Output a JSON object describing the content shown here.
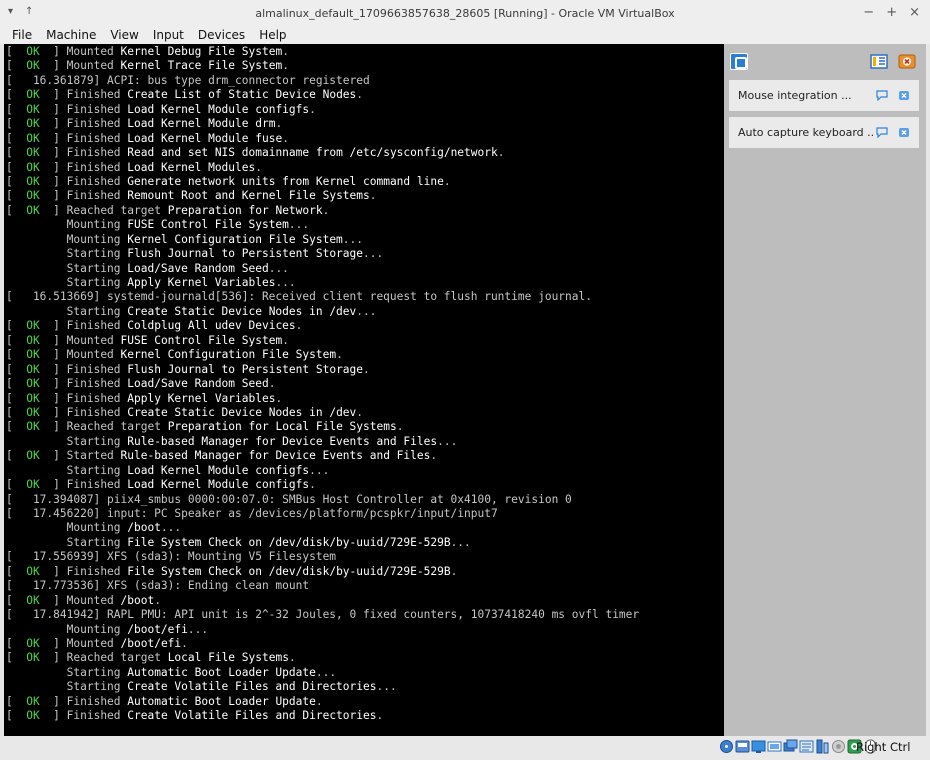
{
  "window": {
    "title": "almalinux_default_1709663857638_28605 [Running] - Oracle VM VirtualBox",
    "controls": {
      "minimize": "−",
      "maximize": "+",
      "close": "×"
    },
    "left_glyphs": [
      "▾",
      "↑"
    ]
  },
  "menubar": {
    "items": [
      "File",
      "Machine",
      "View",
      "Input",
      "Devices",
      "Help"
    ]
  },
  "console": {
    "lines": [
      [
        "[  ",
        {
          "ok": "OK"
        },
        "  ] Mounted ",
        {
          "hl": "Kernel Debug File System"
        },
        "."
      ],
      [
        "[  ",
        {
          "ok": "OK"
        },
        "  ] Mounted ",
        {
          "hl": "Kernel Trace File System"
        },
        "."
      ],
      [
        "[   16.361879] ACPI: bus type drm_connector registered"
      ],
      [
        "[  ",
        {
          "ok": "OK"
        },
        "  ] Finished ",
        {
          "hl": "Create List of Static Device Nodes"
        },
        "."
      ],
      [
        "[  ",
        {
          "ok": "OK"
        },
        "  ] Finished ",
        {
          "hl": "Load Kernel Module configfs"
        },
        "."
      ],
      [
        "[  ",
        {
          "ok": "OK"
        },
        "  ] Finished ",
        {
          "hl": "Load Kernel Module drm"
        },
        "."
      ],
      [
        "[  ",
        {
          "ok": "OK"
        },
        "  ] Finished ",
        {
          "hl": "Load Kernel Module fuse"
        },
        "."
      ],
      [
        "[  ",
        {
          "ok": "OK"
        },
        "  ] Finished ",
        {
          "hl": "Read and set NIS domainname from /etc/sysconfig/network"
        },
        "."
      ],
      [
        "[  ",
        {
          "ok": "OK"
        },
        "  ] Finished ",
        {
          "hl": "Load Kernel Modules"
        },
        "."
      ],
      [
        "[  ",
        {
          "ok": "OK"
        },
        "  ] Finished ",
        {
          "hl": "Generate network units from Kernel command line"
        },
        "."
      ],
      [
        "[  ",
        {
          "ok": "OK"
        },
        "  ] Finished ",
        {
          "hl": "Remount Root and Kernel File Systems"
        },
        "."
      ],
      [
        "[  ",
        {
          "ok": "OK"
        },
        "  ] Reached target ",
        {
          "hl": "Preparation for Network"
        },
        "."
      ],
      [
        "         Mounting ",
        {
          "hl": "FUSE Control File System"
        },
        "..."
      ],
      [
        "         Mounting ",
        {
          "hl": "Kernel Configuration File System"
        },
        "..."
      ],
      [
        "         Starting ",
        {
          "hl": "Flush Journal to Persistent Storage"
        },
        "..."
      ],
      [
        "         Starting ",
        {
          "hl": "Load/Save Random Seed"
        },
        "..."
      ],
      [
        "         Starting ",
        {
          "hl": "Apply Kernel Variables"
        },
        "..."
      ],
      [
        "[   16.513669] systemd-journald[536]: Received client request to flush runtime journal."
      ],
      [
        "         Starting ",
        {
          "hl": "Create Static Device Nodes in /dev"
        },
        "..."
      ],
      [
        "[  ",
        {
          "ok": "OK"
        },
        "  ] Finished ",
        {
          "hl": "Coldplug All udev Devices"
        },
        "."
      ],
      [
        "[  ",
        {
          "ok": "OK"
        },
        "  ] Mounted ",
        {
          "hl": "FUSE Control File System"
        },
        "."
      ],
      [
        "[  ",
        {
          "ok": "OK"
        },
        "  ] Mounted ",
        {
          "hl": "Kernel Configuration File System"
        },
        "."
      ],
      [
        "[  ",
        {
          "ok": "OK"
        },
        "  ] Finished ",
        {
          "hl": "Flush Journal to Persistent Storage"
        },
        "."
      ],
      [
        "[  ",
        {
          "ok": "OK"
        },
        "  ] Finished ",
        {
          "hl": "Load/Save Random Seed"
        },
        "."
      ],
      [
        "[  ",
        {
          "ok": "OK"
        },
        "  ] Finished ",
        {
          "hl": "Apply Kernel Variables"
        },
        "."
      ],
      [
        "[  ",
        {
          "ok": "OK"
        },
        "  ] Finished ",
        {
          "hl": "Create Static Device Nodes in /dev"
        },
        "."
      ],
      [
        "[  ",
        {
          "ok": "OK"
        },
        "  ] Reached target ",
        {
          "hl": "Preparation for Local File Systems"
        },
        "."
      ],
      [
        "         Starting ",
        {
          "hl": "Rule-based Manager for Device Events and Files"
        },
        "..."
      ],
      [
        "[  ",
        {
          "ok": "OK"
        },
        "  ] Started ",
        {
          "hl": "Rule-based Manager for Device Events and Files"
        },
        "."
      ],
      [
        "         Starting ",
        {
          "hl": "Load Kernel Module configfs"
        },
        "..."
      ],
      [
        "[  ",
        {
          "ok": "OK"
        },
        "  ] Finished ",
        {
          "hl": "Load Kernel Module configfs"
        },
        "."
      ],
      [
        "[   17.394087] piix4_smbus 0000:00:07.0: SMBus Host Controller at 0x4100, revision 0"
      ],
      [
        "[   17.456220] input: PC Speaker as /devices/platform/pcspkr/input/input7"
      ],
      [
        "         Mounting ",
        {
          "hl": "/boot"
        },
        "..."
      ],
      [
        "         Starting ",
        {
          "hl": "File System Check on /dev/disk/by-uuid/729E-529B"
        },
        "..."
      ],
      [
        "[   17.556939] XFS (sda3): Mounting V5 Filesystem"
      ],
      [
        "[  ",
        {
          "ok": "OK"
        },
        "  ] Finished ",
        {
          "hl": "File System Check on /dev/disk/by-uuid/729E-529B"
        },
        "."
      ],
      [
        "[   17.773536] XFS (sda3): Ending clean mount"
      ],
      [
        "[  ",
        {
          "ok": "OK"
        },
        "  ] Mounted ",
        {
          "hl": "/boot"
        },
        "."
      ],
      [
        "[   17.841942] RAPL PMU: API unit is 2^-32 Joules, 0 fixed counters, 10737418240 ms ovfl timer"
      ],
      [
        "         Mounting ",
        {
          "hl": "/boot/efi"
        },
        "..."
      ],
      [
        "[  ",
        {
          "ok": "OK"
        },
        "  ] Mounted ",
        {
          "hl": "/boot/efi"
        },
        "."
      ],
      [
        "[  ",
        {
          "ok": "OK"
        },
        "  ] Reached target ",
        {
          "hl": "Local File Systems"
        },
        "."
      ],
      [
        "         Starting ",
        {
          "hl": "Automatic Boot Loader Update"
        },
        "..."
      ],
      [
        "         Starting ",
        {
          "hl": "Create Volatile Files and Directories"
        },
        "..."
      ],
      [
        "[  ",
        {
          "ok": "OK"
        },
        "  ] Finished ",
        {
          "hl": "Automatic Boot Loader Update"
        },
        "."
      ],
      [
        "[  ",
        {
          "ok": "OK"
        },
        "  ] Finished ",
        {
          "hl": "Create Volatile Files and Directories"
        },
        "."
      ]
    ]
  },
  "notification_center": {
    "cards": [
      {
        "label": "Mouse integration ..."
      },
      {
        "label": "Auto capture keyboard ..."
      }
    ],
    "icons": {
      "info": "info-icon",
      "panel": "panel-toggle-icon",
      "close_all": "close-all-icon",
      "card_toggle": "message-toggle-icon",
      "card_close": "card-close-icon"
    }
  },
  "statusbar": {
    "host_key": "Right Ctrl",
    "icons": [
      "hard-disk-icon",
      "optical-drive-icon",
      "audio-icon",
      "network-icon",
      "usb-icon",
      "shared-folders-icon",
      "display-icon",
      "recording-icon",
      "cpu-icon",
      "mouse-integration-icon"
    ]
  },
  "colors": {
    "console_bg": "#000000",
    "console_text": "#c6c6c6",
    "ok_green": "#4cd64c",
    "highlight_white": "#ffffff",
    "panel_bg": "#bdbdbd"
  }
}
